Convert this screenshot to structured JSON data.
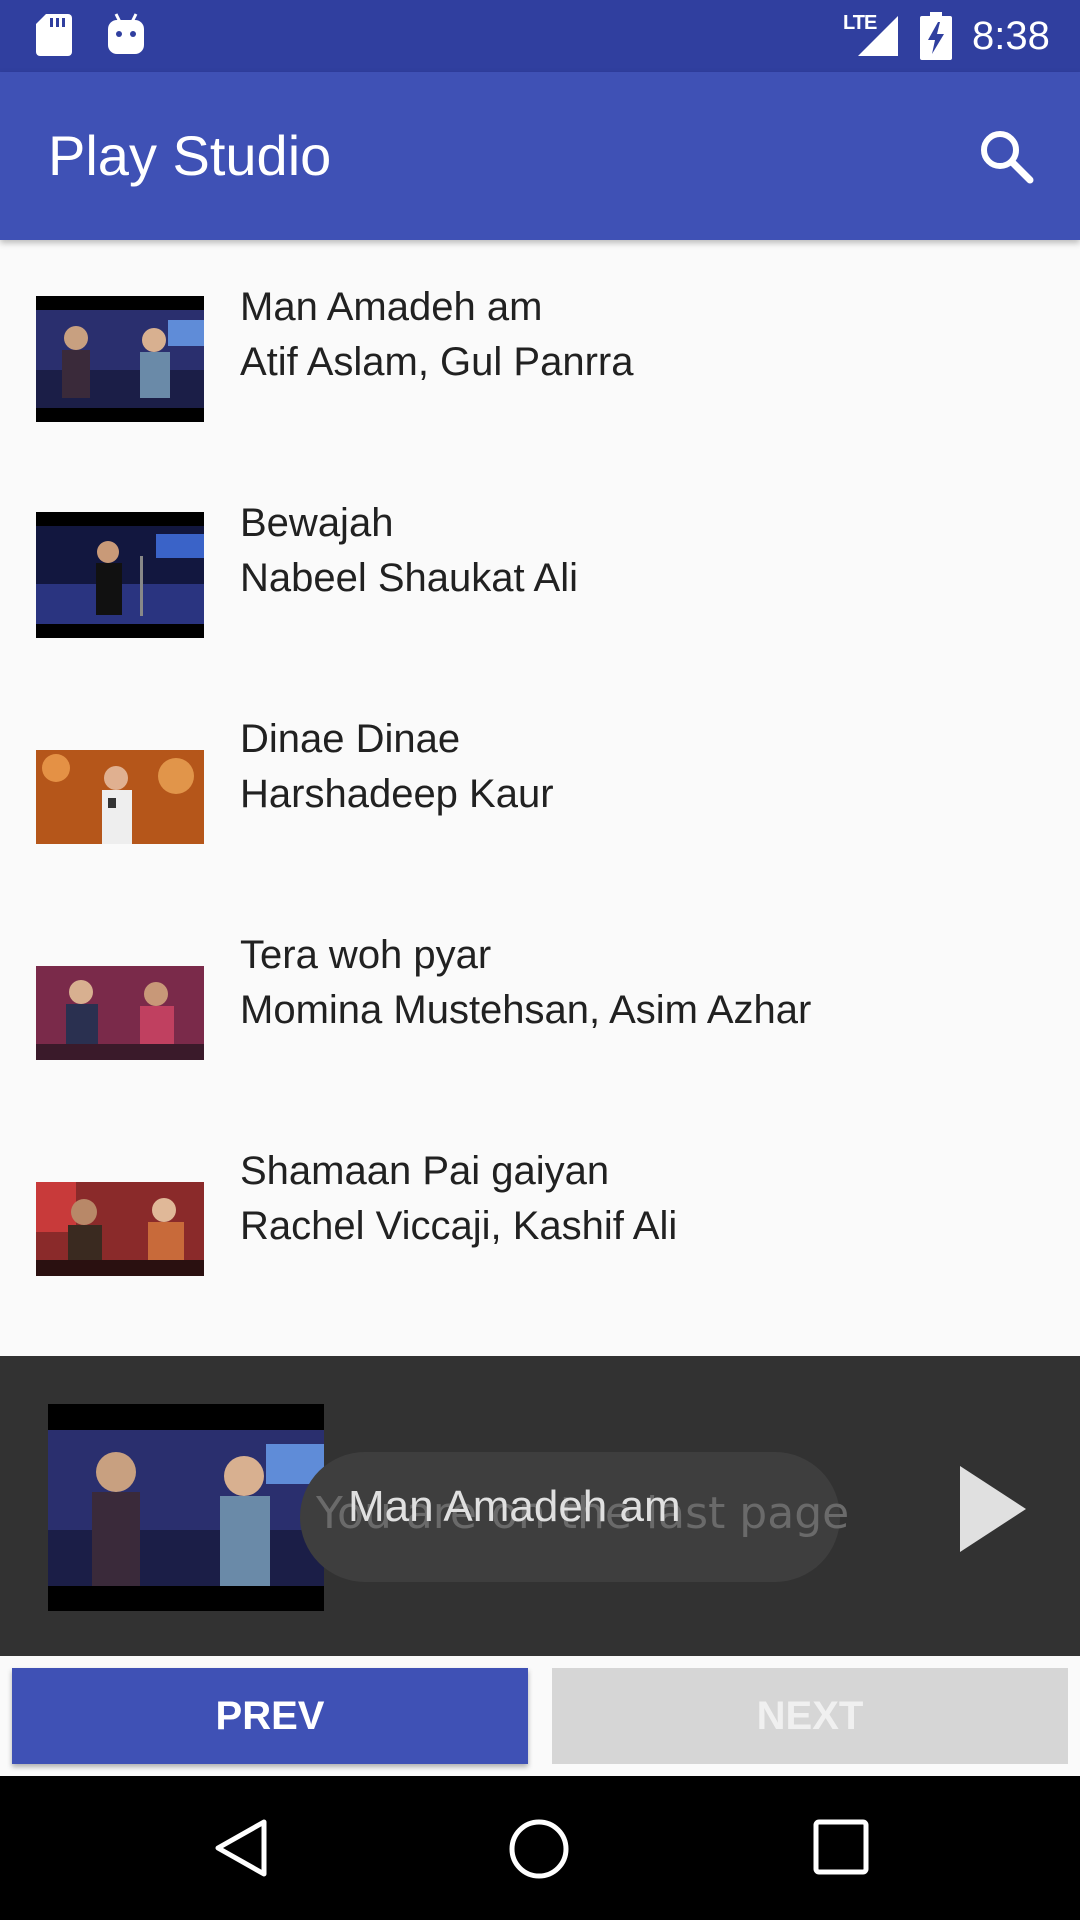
{
  "status_bar": {
    "network_label": "LTE",
    "time": "8:38",
    "icons": [
      "sd-card-icon",
      "android-icon",
      "signal-icon",
      "battery-charging-icon"
    ]
  },
  "app_bar": {
    "title": "Play Studio",
    "search_icon": "search-icon"
  },
  "songs": [
    {
      "title": "Man Amadeh am",
      "artists": "Atif Aslam, Gul Panrra"
    },
    {
      "title": "Bewajah",
      "artists": "Nabeel Shaukat Ali"
    },
    {
      "title": "Dinae Dinae",
      "artists": "Harshadeep Kaur"
    },
    {
      "title": "Tera woh pyar",
      "artists": "Momina Mustehsan, Asim Azhar"
    },
    {
      "title": "Shamaan Pai gaiyan",
      "artists": "Rachel Viccaji, Kashif Ali"
    }
  ],
  "player": {
    "now_playing_title": "Man Amadeh am",
    "toast_message": "You are on the last page",
    "play_icon": "play-icon"
  },
  "pagination": {
    "prev_label": "PREV",
    "next_label": "NEXT"
  },
  "colors": {
    "primary": "#3f51b5",
    "primary_dark": "#303f9f",
    "player_background": "#323232",
    "disabled_button": "#d6d6d6"
  }
}
